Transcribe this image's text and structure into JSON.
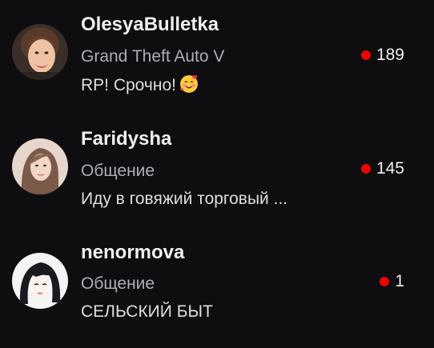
{
  "channels": [
    {
      "name": "OlesyaBulletka",
      "category": "Grand Theft Auto V",
      "title": "RP! Срочно!",
      "title_emoji": "smiling-face-with-hearts-icon",
      "viewers": "189",
      "avatar": "avatar-olesyabulletka"
    },
    {
      "name": "Faridysha",
      "category": "Общение",
      "title": "Иду в говяжий торговый ...",
      "viewers": "145",
      "avatar": "avatar-faridysha"
    },
    {
      "name": "nenormova",
      "category": "Общение",
      "title": "СЕЛЬСКИЙ БЫТ",
      "viewers": "1",
      "avatar": "avatar-nenormova"
    }
  ],
  "colors": {
    "background": "#0e0e10",
    "live_dot": "#eb0400",
    "category_text": "#adadb8",
    "primary_text": "#efeff1"
  }
}
